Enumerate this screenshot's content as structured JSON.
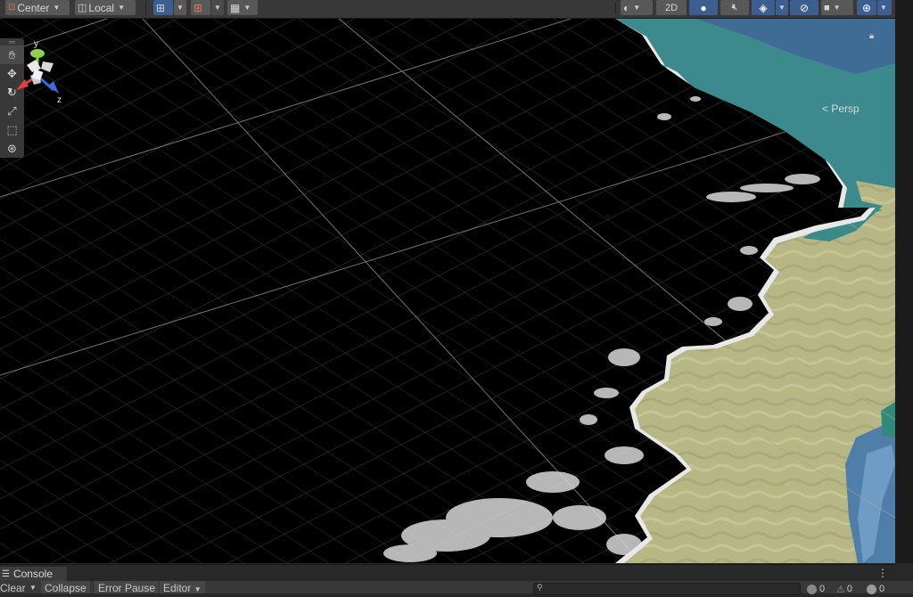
{
  "toolbar": {
    "pivot_mode": "Center",
    "pivot_rotation": "Local",
    "mode_2d": "2D"
  },
  "scene": {
    "projection": "Persp",
    "axis_y": "y",
    "axis_x": "x",
    "axis_z": "z"
  },
  "console": {
    "tab_label": "Console",
    "clear_label": "Clear",
    "collapse_label": "Collapse",
    "error_pause_label": "Error Pause",
    "editor_label": "Editor",
    "log_count": "0",
    "warning_count": "0",
    "error_count": "0"
  },
  "icons": {
    "tools": [
      "hand-tool-icon",
      "move-tool-icon",
      "rotate-tool-icon",
      "scale-tool-icon",
      "rect-tool-icon",
      "transform-tool-icon"
    ]
  },
  "colors": {
    "accent": "#3b5f91",
    "sea": "#3e8a8c",
    "sand": "#b9b98a"
  }
}
